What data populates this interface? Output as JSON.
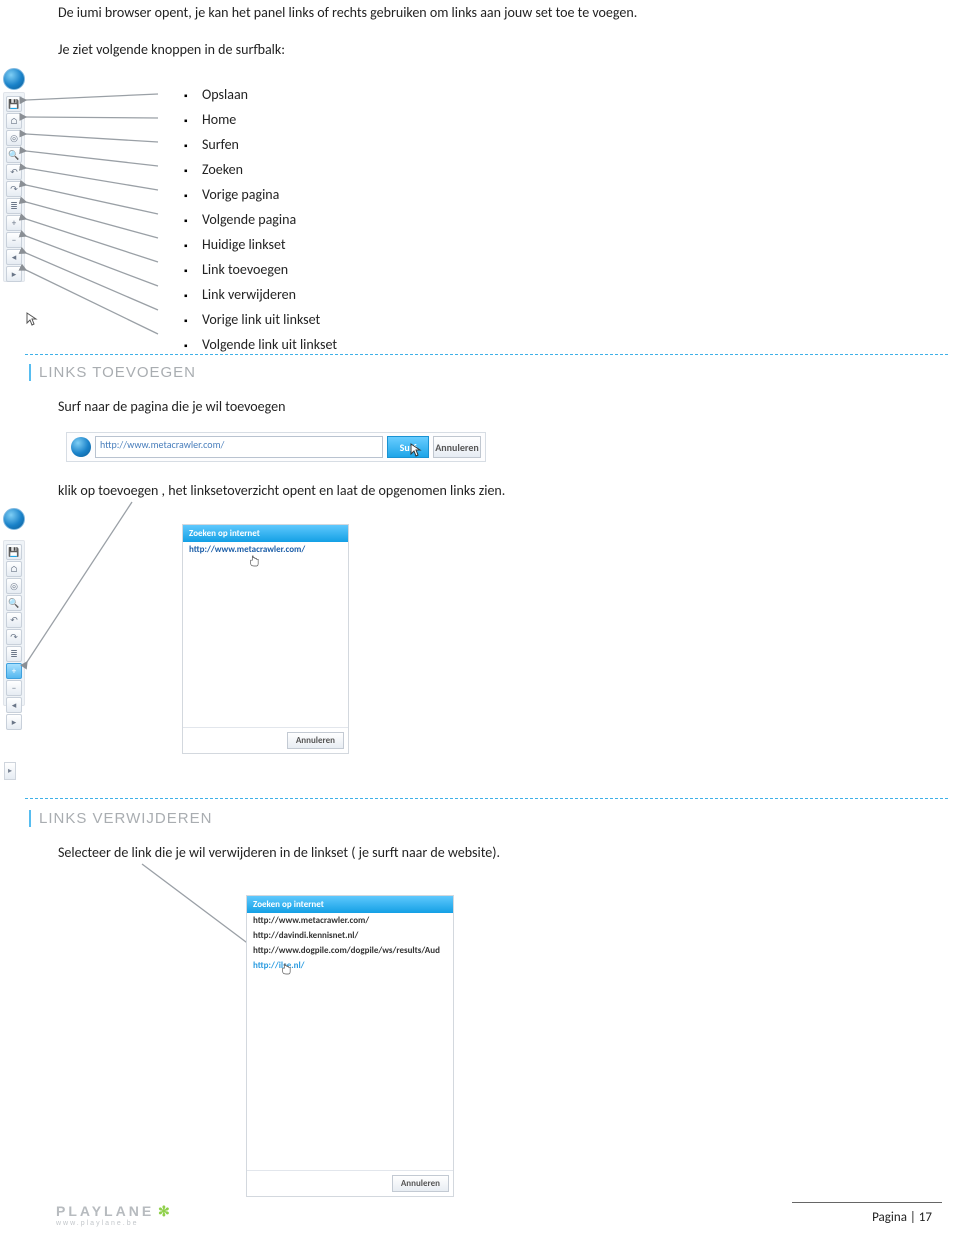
{
  "intro": {
    "line1": "De iumi browser opent, je kan het panel links of rechts gebruiken om links aan jouw set toe te voegen.",
    "line2": "Je ziet volgende knoppen in de surfbalk:"
  },
  "toolbar_labels": [
    "Opslaan",
    "Home",
    "Surfen",
    "Zoeken",
    "Vorige pagina",
    "Volgende pagina",
    "Huidige linkset",
    "Link toevoegen",
    "Link verwijderen",
    "Vorige link uit linkset",
    "Volgende link uit linkset"
  ],
  "toolbar_icons": [
    "save-icon",
    "home-icon",
    "surf-icon",
    "search-icon",
    "back-icon",
    "forward-icon",
    "linkset-icon",
    "add-link-icon",
    "remove-link-icon",
    "prev-link-icon",
    "next-link-icon"
  ],
  "toolbar_glyphs": [
    "💾",
    "⌂",
    "◎",
    "🔍",
    "↶",
    "↷",
    "≣",
    "+",
    "−",
    "◂",
    "▸"
  ],
  "sections": {
    "add": {
      "heading": "LINKS TOEVOEGEN",
      "instr": "Surf naar de pagina die je wil toevoegen",
      "url": "http://www.metacrawler.com/",
      "surf_btn": "Surf",
      "cancel_btn": "Annuleren",
      "after": "klik op toevoegen , het linksetoverzicht opent en laat de opgenomen links zien.",
      "panel_title": "Zoeken op internet",
      "panel_links": [
        "http://www.metacrawler.com/"
      ],
      "panel_cancel": "Annuleren"
    },
    "remove": {
      "heading": "LINKS VERWIJDEREN",
      "instr": "Selecteer de link die je wil verwijderen in de linkset ( je surft naar de website).",
      "panel_title": "Zoeken op internet",
      "panel_links": [
        "http://www.metacrawler.com/",
        "http://davindi.kennisnet.nl/",
        "http://www.dogpile.com/dogpile/ws/results/Aud",
        "http://ilse.nl/"
      ],
      "panel_cancel": "Annuleren"
    }
  },
  "footer": {
    "brand": "PLAYLANE",
    "brand_sub": "www.playlane.be",
    "page_label": "Pagina | 17"
  }
}
